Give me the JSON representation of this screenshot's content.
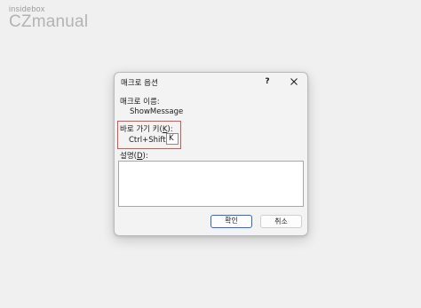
{
  "watermark": {
    "top": "insidebox",
    "bottom": "CZmanual"
  },
  "dialog": {
    "title": "매크로 옵션",
    "help_label": "?",
    "macro_name_label": "매크로 이름:",
    "macro_name_value": "ShowMessage",
    "shortcut_label_prefix": "바로 가기 키(",
    "shortcut_label_key": "K",
    "shortcut_label_suffix": "):",
    "shortcut_prefix": "Ctrl+Shift+",
    "shortcut_key_value": "K",
    "description_label_prefix": "설명(",
    "description_label_key": "D",
    "description_label_suffix": "):",
    "description_value": "",
    "ok_label": "확인",
    "cancel_label": "취소"
  },
  "colors": {
    "highlight": "#d9534f",
    "primary_button_border": "#2b6cc4"
  }
}
